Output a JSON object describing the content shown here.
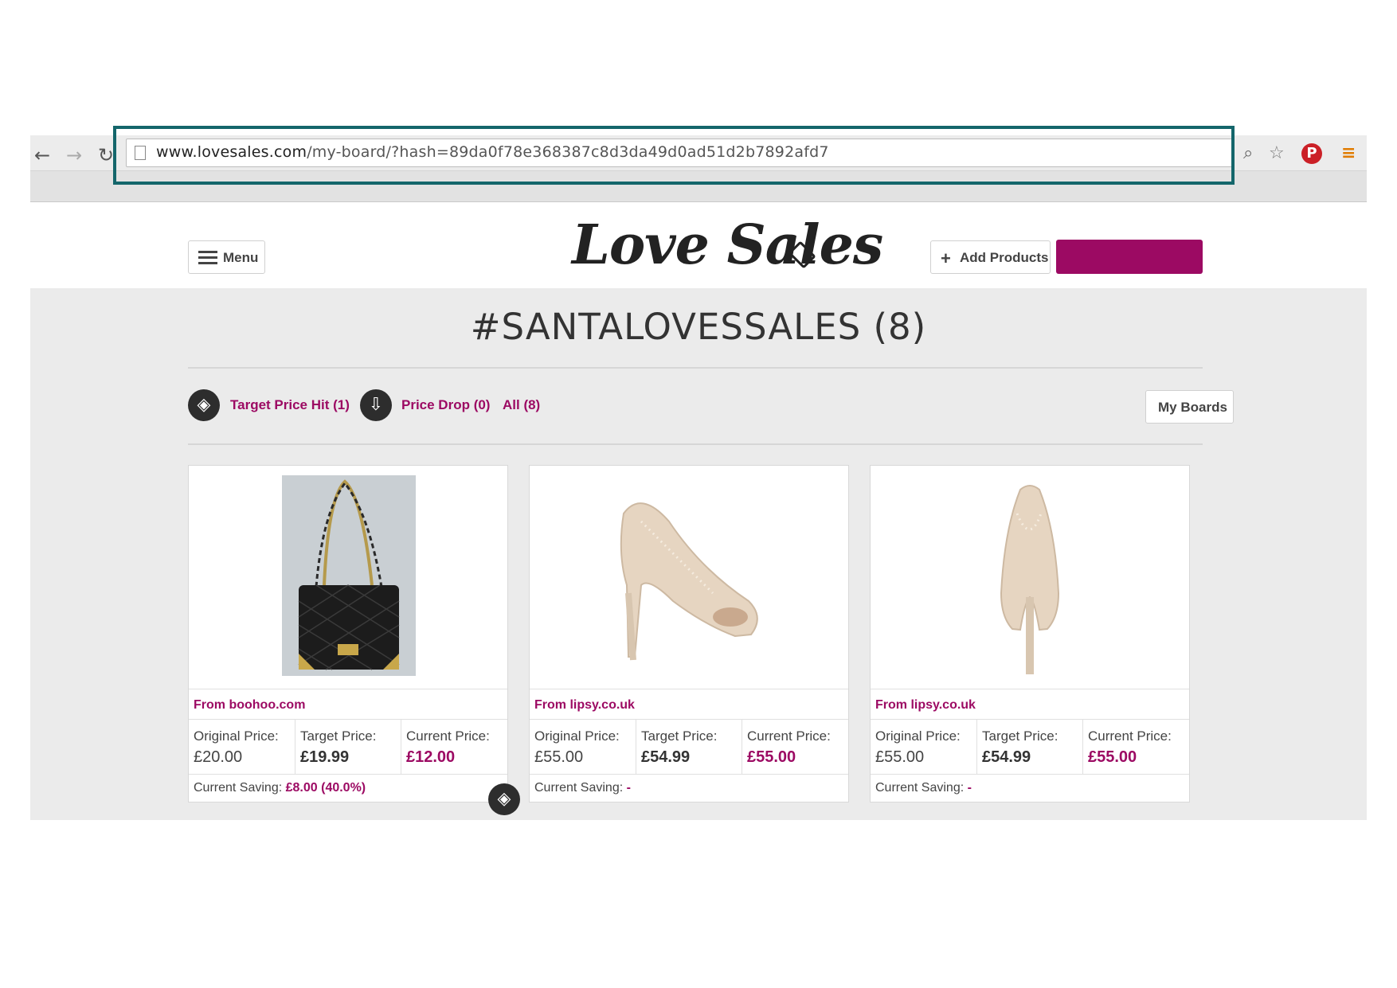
{
  "browser": {
    "url_host": "www.lovesales.com",
    "url_path": "/my-board/?hash=89da0f78e368387c8d3da49d0ad51d2b7892afd7"
  },
  "header": {
    "menu_label": "Menu",
    "logo_text": "Love Sales",
    "add_products_label": "Add Products",
    "cta_label": ""
  },
  "board": {
    "title": "#SANTALOVESSALES (8)",
    "filters": {
      "target_price_hit": "Target Price Hit (1)",
      "price_drop": "Price Drop (0)",
      "all": "All (8)"
    },
    "my_boards_label": "My Boards"
  },
  "products": [
    {
      "image": "black-quilted-handbag",
      "from": "From boohoo.com",
      "original_label": "Original Price:",
      "original_value": "£20.00",
      "target_label": "Target Price:",
      "target_value": "£19.99",
      "current_label": "Current Price:",
      "current_value": "£12.00",
      "saving_label": "Current Saving:",
      "saving_value": "£8.00 (40.0%)"
    },
    {
      "image": "glitter-peep-toe-heel-side",
      "from": "From lipsy.co.uk",
      "original_label": "Original Price:",
      "original_value": "£55.00",
      "target_label": "Target Price:",
      "target_value": "£54.99",
      "current_label": "Current Price:",
      "current_value": "£55.00",
      "saving_label": "Current Saving:",
      "saving_value": "-"
    },
    {
      "image": "glitter-heel-back",
      "from": "From lipsy.co.uk",
      "original_label": "Original Price:",
      "original_value": "£55.00",
      "target_label": "Target Price:",
      "target_value": "£54.99",
      "current_label": "Current Price:",
      "current_value": "£55.00",
      "saving_label": "Current Saving:",
      "saving_value": "-"
    }
  ],
  "colors": {
    "accent": "#9c0a63",
    "highlight_border": "#14666b",
    "dark_icon": "#2d2d2d",
    "page_bg": "#ebebeb"
  }
}
